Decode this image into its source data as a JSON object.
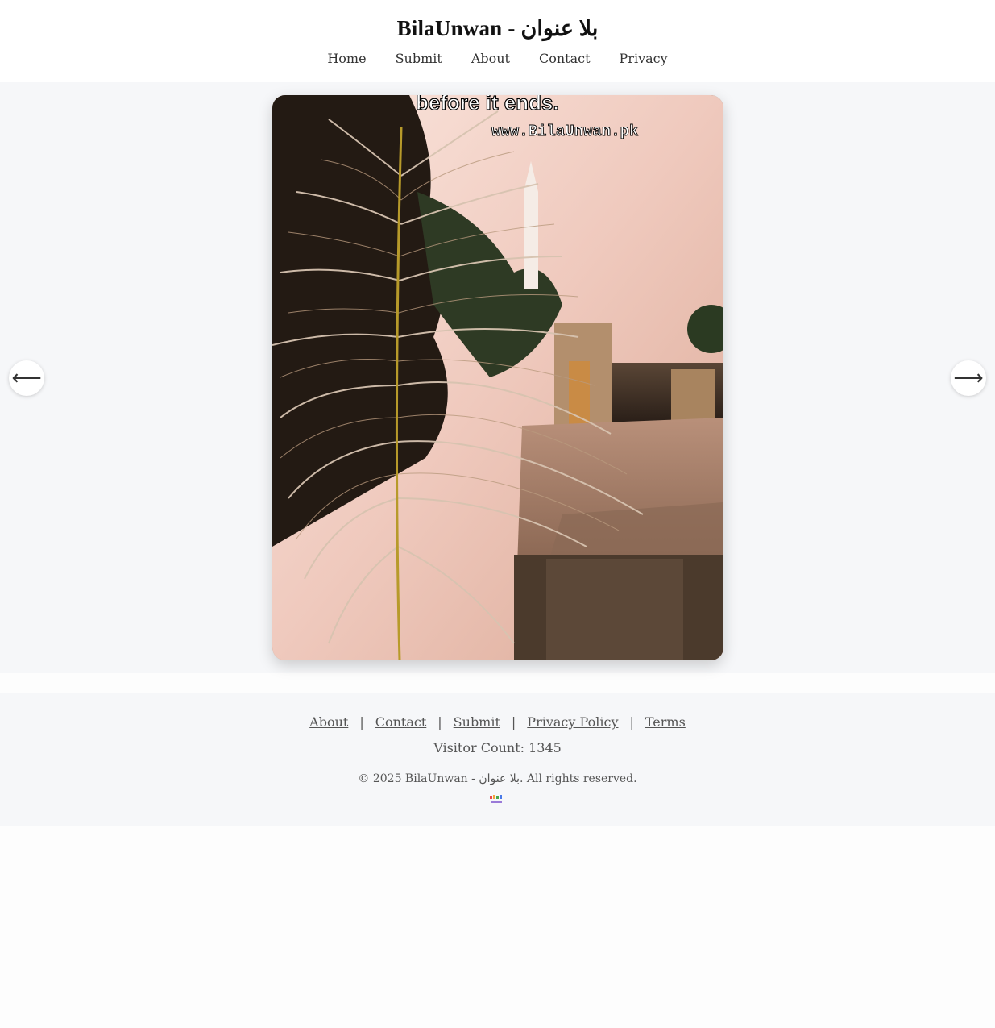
{
  "header": {
    "title": "BilaUnwan - بلا عنوان",
    "nav": [
      "Home",
      "Submit",
      "About",
      "Contact",
      "Privacy"
    ]
  },
  "slide": {
    "caption_top": "before it ends.",
    "caption_url": "www.BilaUnwan.pk",
    "prev_icon": "arrow-left-icon",
    "next_icon": "arrow-right-icon",
    "prev_glyph": "⟵",
    "next_glyph": "⟶"
  },
  "footer": {
    "links": [
      "About",
      "Contact",
      "Submit",
      "Privacy Policy",
      "Terms"
    ],
    "separator": "|",
    "visitor_count": "Visitor Count: 1345",
    "copyright": "© 2025 BilaUnwan - بلا عنوان. All rights reserved.",
    "logo_icon": "bilaunwan-logo-icon"
  }
}
